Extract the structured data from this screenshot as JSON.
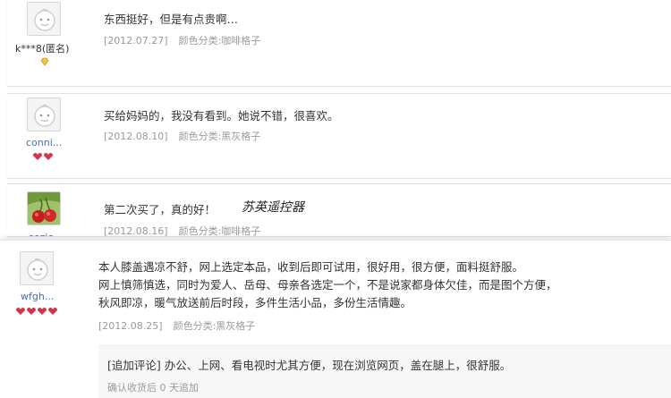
{
  "reviews": [
    {
      "user": "k***8(匿名)",
      "content": "东西挺好，但是有点贵啊…",
      "date": "[2012.07.27]",
      "sku": "颜色分类:咖啡格子"
    },
    {
      "user": "conni...",
      "content": "买给妈妈的，我没有看到。她说不错，很喜欢。",
      "date": "[2012.08.10]",
      "sku": "颜色分类:黑灰格子"
    },
    {
      "user": "sezic",
      "content": "第二次买了，真的好！",
      "brand_overlay": "苏英遥控器",
      "date": "[2012.08.16]",
      "sku": "颜色分类:咖啡格子"
    },
    {
      "user": "wfgh...",
      "content_lines": [
        "本人膝盖遇凉不舒，网上选定本品，收到后即可试用，很好用，很方便，面料挺舒服。",
        "网上慎筛慎选，同时为爱人、岳母、母亲各选定一个，不是说家都身体欠佳，而是图个方便，",
        "秋风即凉，暖气放送前后时段，多件生活小品，多份生活情趣。"
      ],
      "date": "[2012.08.25]",
      "sku": "颜色分类:黑灰格子",
      "append": {
        "text": "[追加评论] 办公、上网、看电视时尤其方便，现在浏览网页，盖在腿上，很舒服。",
        "sub": "确认收货后 0 天追加"
      }
    }
  ],
  "colors": {
    "username_blue": "#3e6fb0",
    "meta_gray": "#9a9a9a",
    "badge_red": "#d4344a",
    "badge_gold": "#f2c23a"
  },
  "icons": {
    "avatar_default": "default-avatar-icon",
    "avatar_cherry": "cherry-avatar-icon",
    "rank_gold": "gold-diamond-icon",
    "rank_red": "red-heart-icon"
  }
}
